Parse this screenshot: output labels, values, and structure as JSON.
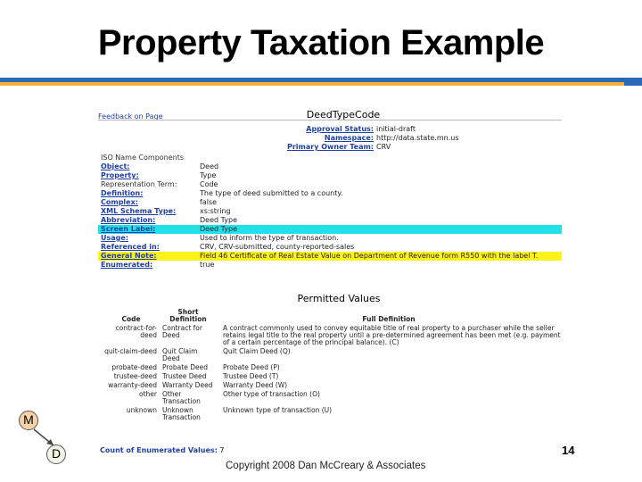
{
  "slide": {
    "title": "Property Taxation Example",
    "page_number": "14",
    "copyright": "Copyright 2008 Dan McCreary & Associates",
    "nodes": {
      "m": "M",
      "d": "D"
    }
  },
  "screenshot": {
    "feedback": "Feedback on Page",
    "title": "DeedTypeCode",
    "meta": [
      {
        "key": "Approval Status:",
        "value": "initial-draft"
      },
      {
        "key": "Namespace:",
        "value": "http://data.state.mn.us"
      },
      {
        "key": "Primary Owner Team:",
        "value": "CRV"
      }
    ],
    "iso_name": "ISO Name Components",
    "attributes": [
      {
        "key": "Object:",
        "value": "Deed",
        "style": ""
      },
      {
        "key": "Property:",
        "value": "Type",
        "style": ""
      },
      {
        "key": "Representation Term:",
        "value": "Code",
        "style": "plain"
      },
      {
        "key": "Definition:",
        "value": "The type of deed submitted to a county.",
        "style": ""
      },
      {
        "key": "Complex:",
        "value": "false",
        "style": ""
      },
      {
        "key": "XML Schema Type:",
        "value": "xs:string",
        "style": ""
      },
      {
        "key": "Abbreviation:",
        "value": "Deed Type",
        "style": ""
      },
      {
        "key": "Screen Label:",
        "value": "Deed Type",
        "style": "cyan"
      },
      {
        "key": "Usage:",
        "value": "Used to inform the type of transaction.",
        "style": ""
      },
      {
        "key": "Referenced in:",
        "value": "CRV, CRV-submitted, county-reported-sales",
        "style": ""
      },
      {
        "key": "General Note:",
        "value": "Field 46 Certificate of Real Estate Value on Department of Revenue form R550 with the label T.",
        "style": "yellow"
      },
      {
        "key": "Enumerated:",
        "value": "true",
        "style": ""
      }
    ],
    "permitted_values": {
      "title": "Permitted Values",
      "headers": {
        "code": "Code",
        "short": "Short Definition",
        "full": "Full Definition"
      },
      "rows": [
        {
          "code": "contract-for-deed",
          "short": "Contract for Deed",
          "full": "A contract commonly used to convey equitable title of real property to a purchaser while the seller retains legal title to the real property until a pre-determined agreement has been met (e.g. payment of a certain percentage of the principal balance). (C)"
        },
        {
          "code": "quit-claim-deed",
          "short": "Quit Claim Deed",
          "full": "Quit Claim Deed (Q)"
        },
        {
          "code": "probate-deed",
          "short": "Probate Deed",
          "full": "Probate Deed (P)"
        },
        {
          "code": "trustee-deed",
          "short": "Trustee Deed",
          "full": "Trustee Deed (T)"
        },
        {
          "code": "warranty-deed",
          "short": "Warranty Deed",
          "full": "Warranty Deed (W)"
        },
        {
          "code": "other",
          "short": "Other Transaction",
          "full": "Other type of transaction (O)"
        },
        {
          "code": "unknown",
          "short": "Unknown Transaction",
          "full": "Unknown type of transaction (U)"
        }
      ]
    },
    "enum_count": {
      "label": "Count of Enumerated Values:",
      "value": "7"
    }
  }
}
